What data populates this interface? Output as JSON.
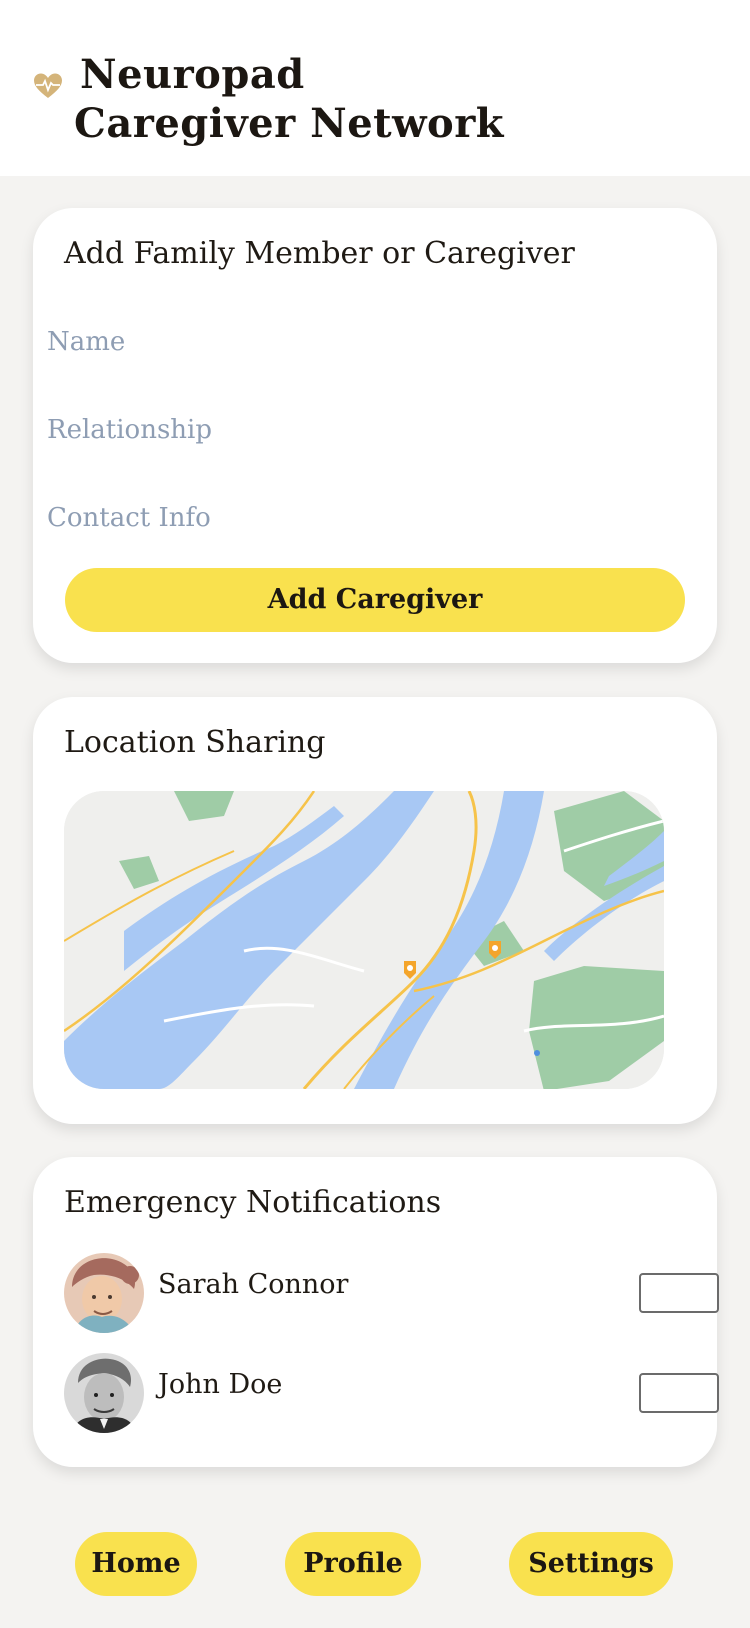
{
  "header": {
    "title_line1": "Neuropad",
    "title_line2": "Caregiver Network",
    "logo_icon": "heart-pulse-icon",
    "logo_color": "#d4b47a"
  },
  "add_caregiver": {
    "title": "Add Family Member or Caregiver",
    "name_placeholder": "Name",
    "relationship_placeholder": "Relationship",
    "contact_placeholder": "Contact Info",
    "button_label": "Add Caregiver"
  },
  "location": {
    "title": "Location Sharing",
    "map_icon": "map-image",
    "marker_icon": "location-pin-icon"
  },
  "emergency": {
    "title": "Emergency Notifications",
    "contacts": [
      {
        "name": "Sarah Connor",
        "avatar": "avatar-woman-portrait"
      },
      {
        "name": "John Doe",
        "avatar": "avatar-man-portrait"
      }
    ]
  },
  "nav": {
    "home": "Home",
    "profile": "Profile",
    "settings": "Settings"
  },
  "colors": {
    "accent": "#f9e14e",
    "background": "#f4f3f1",
    "card": "#ffffff",
    "placeholder": "#8e9db3",
    "water": "#a8c8f4",
    "park": "#9fcca6",
    "road": "#f6c34a"
  }
}
